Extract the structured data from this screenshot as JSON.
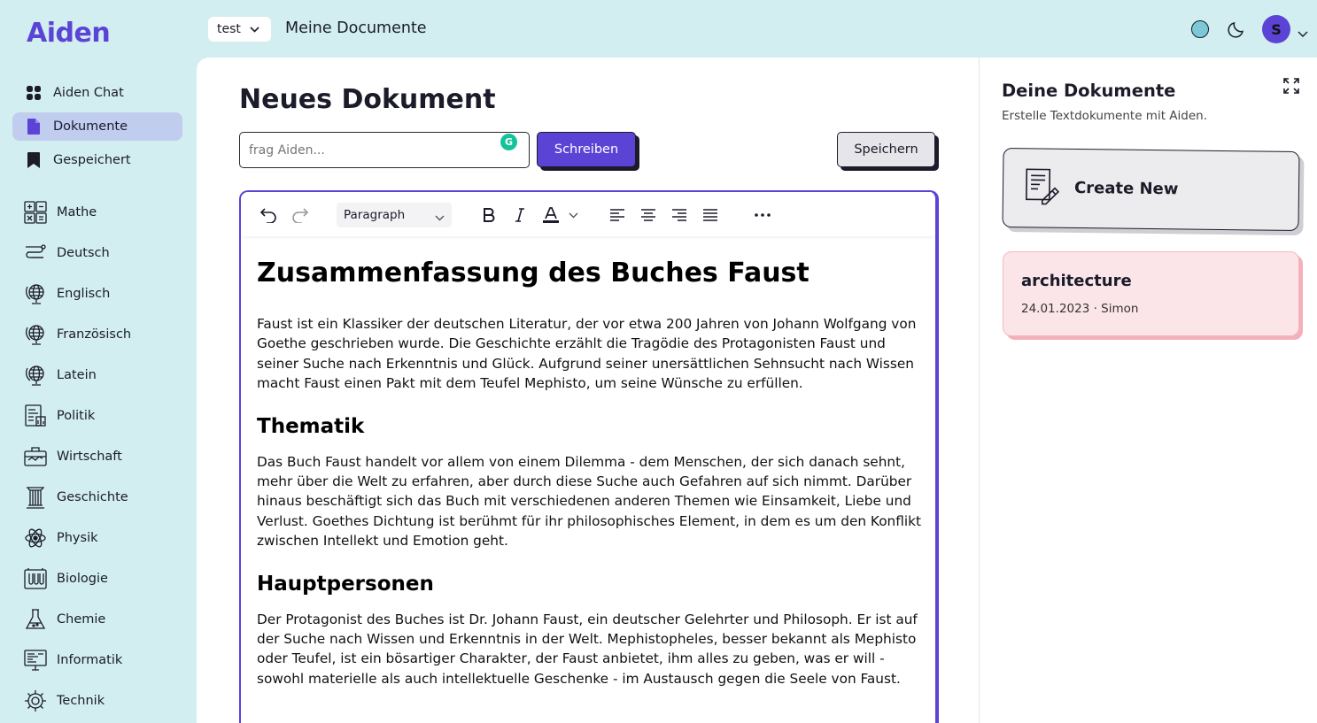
{
  "app": {
    "logo": "Aiden"
  },
  "nav": [
    {
      "label": "Aiden Chat",
      "icon": "grid-icon"
    },
    {
      "label": "Dokumente",
      "icon": "document-icon",
      "active": true
    },
    {
      "label": "Gespeichert",
      "icon": "bookmark-icon"
    }
  ],
  "subjects": [
    {
      "label": "Mathe",
      "icon": "math-icon"
    },
    {
      "label": "Deutsch",
      "icon": "deutsch-icon"
    },
    {
      "label": "Englisch",
      "icon": "globe-icon"
    },
    {
      "label": "Französisch",
      "icon": "globe-icon"
    },
    {
      "label": "Latein",
      "icon": "globe-icon"
    },
    {
      "label": "Politik",
      "icon": "politics-icon"
    },
    {
      "label": "Wirtschaft",
      "icon": "briefcase-icon"
    },
    {
      "label": "Geschichte",
      "icon": "column-icon"
    },
    {
      "label": "Physik",
      "icon": "atom-icon"
    },
    {
      "label": "Biologie",
      "icon": "microscope-icon"
    },
    {
      "label": "Chemie",
      "icon": "flask-icon"
    },
    {
      "label": "Informatik",
      "icon": "monitor-icon"
    },
    {
      "label": "Technik",
      "icon": "gear-icon"
    }
  ],
  "topbar": {
    "workspace": "test",
    "title": "Meine Documente",
    "avatar_initial": "S"
  },
  "main": {
    "title": "Neues Dokument",
    "ask_placeholder": "frag Aiden...",
    "write_label": "Schreiben",
    "save_label": "Speichern",
    "paragraph_style": "Paragraph"
  },
  "document": {
    "title": "Zusammenfassung des Buches Faust",
    "intro": "Faust ist ein Klassiker der deutschen Literatur, der vor etwa 200 Jahren von Johann Wolfgang von Goethe geschrieben wurde. Die Geschichte erzählt die Tragödie des Protagonisten Faust und seiner Suche nach Erkenntnis und Glück. Aufgrund seiner unersättlichen Sehnsucht nach Wissen macht Faust einen Pakt mit dem Teufel Mephisto, um seine Wünsche zu erfüllen.",
    "h_thematik": "Thematik",
    "thematik": "Das Buch Faust handelt vor allem von einem Dilemma - dem Menschen, der sich danach sehnt, mehr über die Welt zu erfahren, aber durch diese Suche auch Gefahren auf sich nimmt. Darüber hinaus beschäftigt sich das Buch mit verschiedenen anderen Themen wie Einsamkeit, Liebe und Verlust. Goethes Dichtung ist berühmt für ihr philosophisches Element, in dem es um den Konflikt zwischen Intellekt und Emotion geht.",
    "h_personen": "Hauptpersonen",
    "personen": "Der Protagonist des Buches ist Dr. Johann Faust, ein deutscher Gelehrter und Philosoph. Er ist auf der Suche nach Wissen und Erkenntnis in der Welt. Mephistopheles, besser bekannt als Mephisto oder Teufel, ist ein bösartiger Charakter, der Faust anbietet, ihm alles zu geben, was er will - sowohl materielle als auch intellektuelle Geschenke - im Austausch gegen die Seele von Faust."
  },
  "right": {
    "title": "Deine Dokumente",
    "subtitle": "Erstelle Textdokumente mit Aiden.",
    "create_label": "Create New",
    "docs": [
      {
        "title": "architecture",
        "meta": "24.01.2023 · Simon"
      }
    ]
  },
  "colors": {
    "accent": "#5b43d6",
    "background": "#d2eef0",
    "card_pink": "#fbe5e8"
  }
}
